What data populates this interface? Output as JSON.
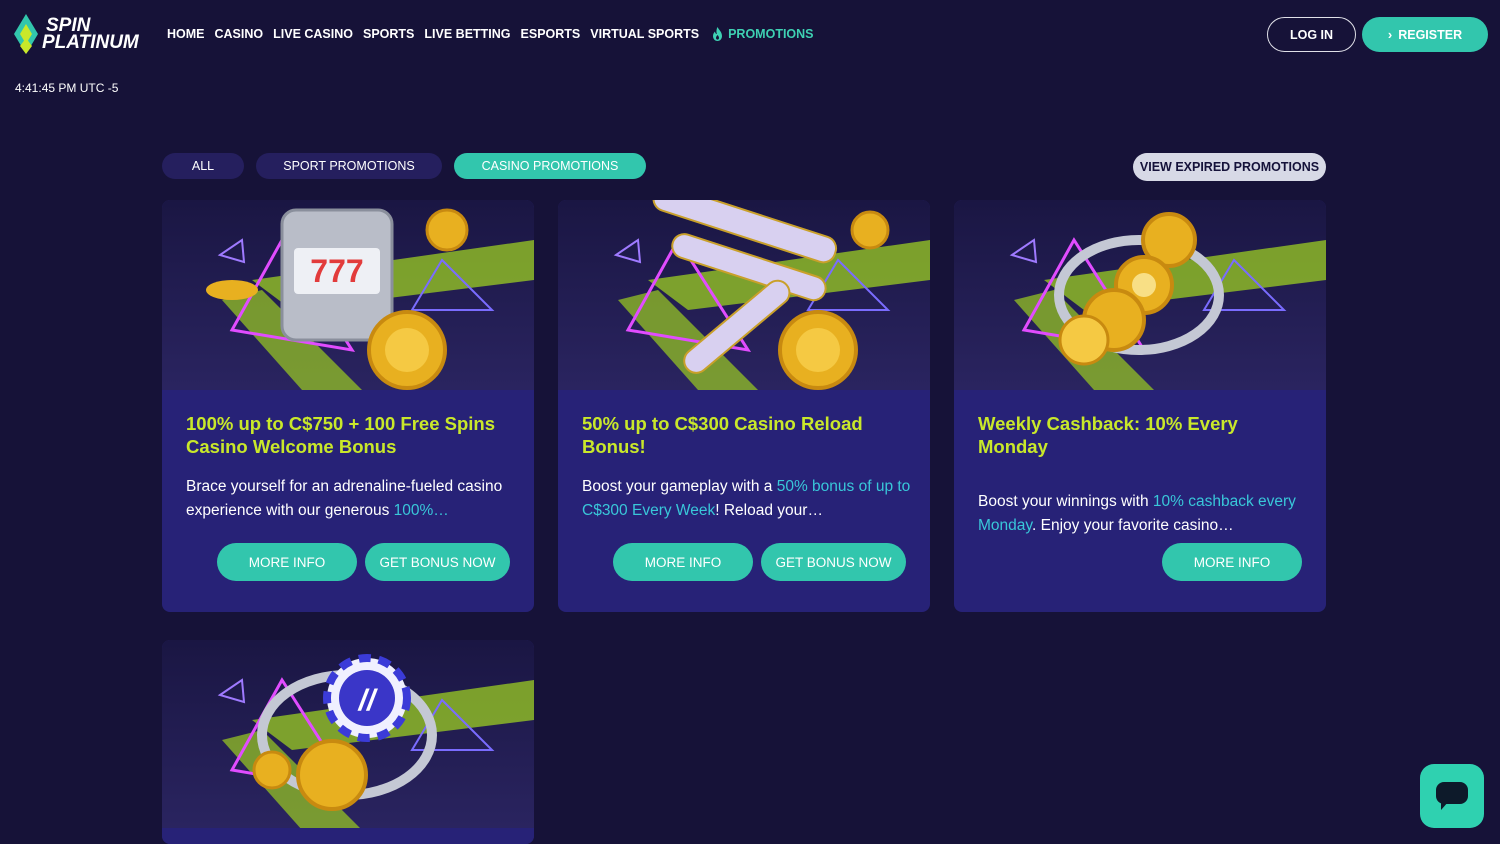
{
  "brand": {
    "line1": "SPIN",
    "line2": "PLATINUM"
  },
  "nav": {
    "items": [
      {
        "label": "HOME"
      },
      {
        "label": "CASINO"
      },
      {
        "label": "LIVE CASINO"
      },
      {
        "label": "SPORTS"
      },
      {
        "label": "LIVE BETTING"
      },
      {
        "label": "ESPORTS"
      },
      {
        "label": "VIRTUAL SPORTS"
      }
    ],
    "promotions_label": "PROMOTIONS"
  },
  "auth": {
    "login_label": "LOG IN",
    "register_label": "REGISTER"
  },
  "clock": "4:41:45 PM UTC -5",
  "filters": {
    "all": "ALL",
    "sport": "SPORT PROMOTIONS",
    "casino": "CASINO PROMOTIONS",
    "active": "casino"
  },
  "expired_label": "VIEW EXPIRED PROMOTIONS",
  "cards": [
    {
      "title": "100% up to C$750 + 100 Free Spins Casino Welcome Bonus",
      "text_before": "Brace yourself for an adrenaline-fueled casino experience with our generous ",
      "text_highlight": "100%…",
      "text_after": "",
      "more_info": "MORE INFO",
      "get_bonus": "GET BONUS NOW",
      "image_icon": "slot-machine-coins-image"
    },
    {
      "title": "50% up to C$300 Casino Reload Bonus!",
      "text_before": "Boost your gameplay with a ",
      "text_highlight": "50% bonus of up to C$300 Every Week",
      "text_after": "! Reload your…",
      "more_info": "MORE INFO",
      "get_bonus": "GET BONUS NOW",
      "image_icon": "slot-reels-image"
    },
    {
      "title": "Weekly Cashback: 10% Every Monday",
      "text_before": "Boost your winnings with ",
      "text_highlight": "10% cashback every Monday",
      "text_after": ". Enjoy your favorite casino…",
      "more_info": "MORE INFO",
      "image_icon": "cashback-coins-image"
    },
    {
      "image_icon": "casino-chip-image"
    }
  ],
  "colors": {
    "background": "#161238",
    "card": "#272277",
    "accent": "#32c6ad",
    "title_yellow": "#c9e82a",
    "highlight": "#39c7d9"
  }
}
